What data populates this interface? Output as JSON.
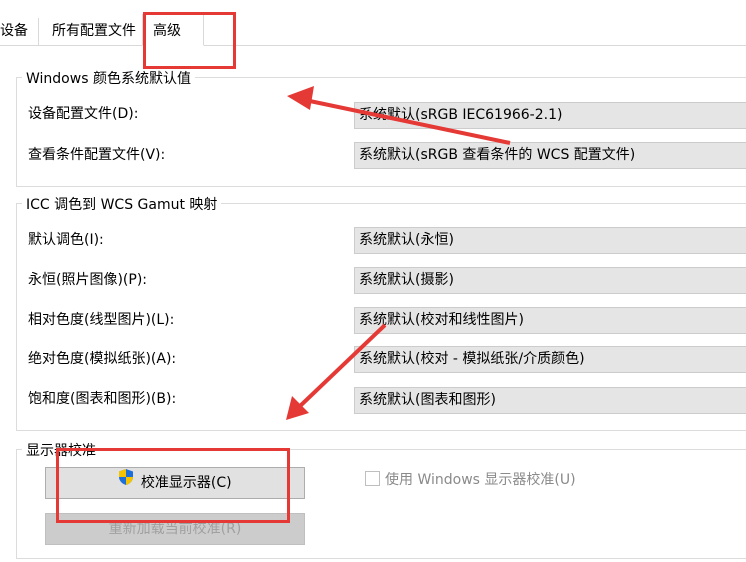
{
  "tabs": [
    {
      "label": "设备"
    },
    {
      "label": "所有配置文件"
    },
    {
      "label": "高级"
    }
  ],
  "windows_defaults": {
    "title": "Windows 颜色系统默认值",
    "rows": [
      {
        "label": "设备配置文件(D):",
        "value": "系统默认(sRGB IEC61966-2.1)"
      },
      {
        "label": "查看条件配置文件(V):",
        "value": "系统默认(sRGB 查看条件的 WCS 配置文件)"
      }
    ]
  },
  "gamut_mapping": {
    "title": "ICC 调色到 WCS Gamut 映射",
    "rows": [
      {
        "label": "默认调色(I):",
        "value": "系统默认(永恒)"
      },
      {
        "label": "永恒(照片图像)(P):",
        "value": "系统默认(摄影)"
      },
      {
        "label": "相对色度(线型图片)(L):",
        "value": "系统默认(校对和线性图片)"
      },
      {
        "label": "绝对色度(模拟纸张)(A):",
        "value": "系统默认(校对 - 模拟纸张/介质颜色)"
      },
      {
        "label": "饱和度(图表和图形)(B):",
        "value": "系统默认(图表和图形)"
      }
    ]
  },
  "calibration": {
    "title": "显示器校准",
    "calibrate_button": "校准显示器(C)",
    "reload_button": "重新加载当前校准(R)",
    "use_windows_checkbox": "使用 Windows 显示器校准(U)",
    "use_windows_checked": false
  },
  "colors": {
    "annotation": "#e53935",
    "select_bg": "#e5e5e5",
    "shield_blue": "#1e6fd9",
    "shield_yellow": "#f5c400"
  }
}
